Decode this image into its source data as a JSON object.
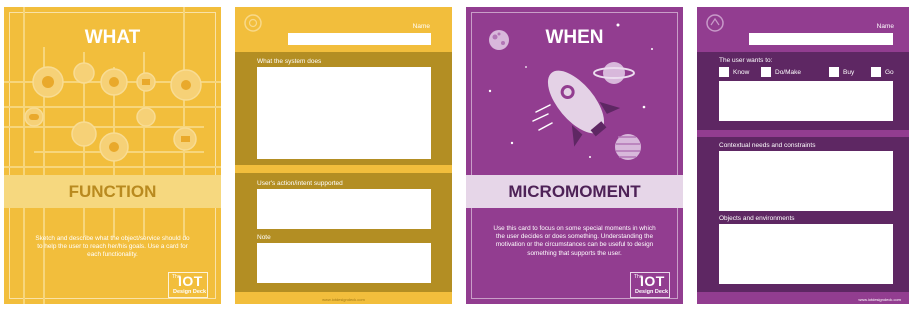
{
  "cards": {
    "what": {
      "title": "WHAT",
      "band": "FUNCTION",
      "description": "Sketch and describe what the object/service should do to help the user to reach her/his goals. Use a card for each functionality.",
      "logo_the": "The",
      "logo_iot": "IOT",
      "logo_deck": "Design Deck"
    },
    "what_back": {
      "name_label": "Name",
      "field1_label": "What the system does",
      "field2_label": "User's action/intent supported",
      "field3_label": "Note",
      "footer": "www.iotdesigndeck.com"
    },
    "when": {
      "title": "WHEN",
      "band": "MICROMOMENT",
      "description": "Use this card to focus on some special moments in which the user decides or does something. Understanding the motivation or the circumstances can be useful to design something that supports the user.",
      "logo_the": "The",
      "logo_iot": "IOT",
      "logo_deck": "Design Deck"
    },
    "when_back": {
      "name_label": "Name",
      "wants_label": "The user wants to:",
      "options": [
        "Know",
        "Do/Make",
        "Buy",
        "Go"
      ],
      "field2_label": "Contextual needs and constraints",
      "field3_label": "Objects and environments",
      "footer": "www.iotdesigndeck.com"
    }
  },
  "colors": {
    "yellow": "#f2be3c",
    "yellow_light": "#f6d87f",
    "olive": "#b38e23",
    "purple": "#923d90",
    "purple_dark": "#5e2763",
    "band_purple_bg": "#e6d6e8",
    "band_purple_text": "#4e2257",
    "band_yellow_text": "#b98a1f"
  }
}
